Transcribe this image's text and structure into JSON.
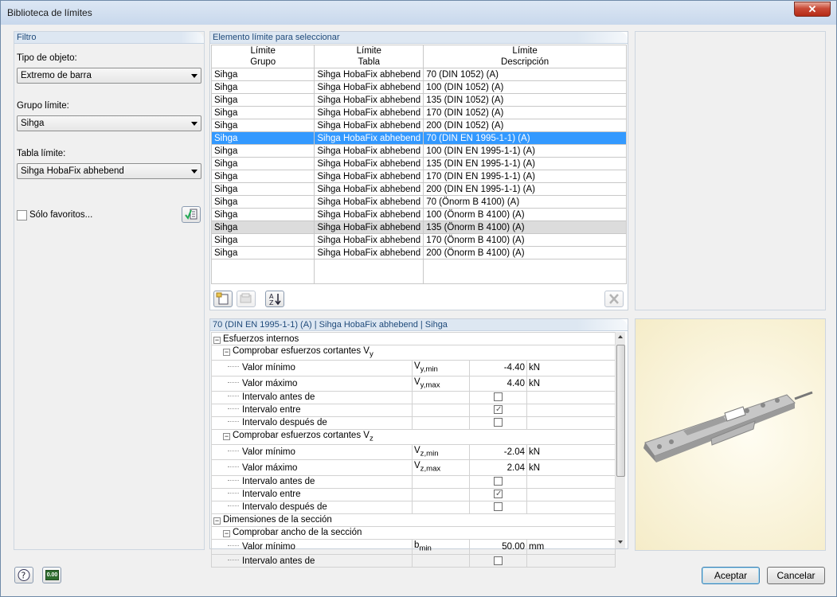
{
  "window": {
    "title": "Biblioteca de límites",
    "close_label": "✕"
  },
  "filter": {
    "header": "Filtro",
    "object_type_label": "Tipo de objeto:",
    "object_type_value": "Extremo de barra",
    "group_label": "Grupo límite:",
    "group_value": "Sihga",
    "table_label": "Tabla límite:",
    "table_value": "Sihga HobaFix abhebend",
    "favorites_label": "Sólo favoritos..."
  },
  "list": {
    "header": "Elemento límite para seleccionar",
    "columns": [
      {
        "top": "Límite",
        "bottom": "Grupo"
      },
      {
        "top": "Límite",
        "bottom": "Tabla"
      },
      {
        "top": "Límite",
        "bottom": "Descripción"
      }
    ],
    "rows": [
      [
        "Sihga",
        "Sihga HobaFix abhebend",
        "70 (DIN 1052) (A)"
      ],
      [
        "Sihga",
        "Sihga HobaFix abhebend",
        "100 (DIN 1052) (A)"
      ],
      [
        "Sihga",
        "Sihga HobaFix abhebend",
        "135 (DIN 1052) (A)"
      ],
      [
        "Sihga",
        "Sihga HobaFix abhebend",
        "170 (DIN 1052) (A)"
      ],
      [
        "Sihga",
        "Sihga HobaFix abhebend",
        "200 (DIN 1052) (A)"
      ],
      [
        "Sihga",
        "Sihga HobaFix abhebend",
        "70 (DIN EN 1995-1-1) (A)"
      ],
      [
        "Sihga",
        "Sihga HobaFix abhebend",
        "100 (DIN EN 1995-1-1) (A)"
      ],
      [
        "Sihga",
        "Sihga HobaFix abhebend",
        "135 (DIN EN 1995-1-1) (A)"
      ],
      [
        "Sihga",
        "Sihga HobaFix abhebend",
        "170 (DIN EN 1995-1-1) (A)"
      ],
      [
        "Sihga",
        "Sihga HobaFix abhebend",
        "200 (DIN EN 1995-1-1) (A)"
      ],
      [
        "Sihga",
        "Sihga HobaFix abhebend",
        "70 (Önorm B 4100) (A)"
      ],
      [
        "Sihga",
        "Sihga HobaFix abhebend",
        "100 (Önorm B 4100) (A)"
      ],
      [
        "Sihga",
        "Sihga HobaFix abhebend",
        "135 (Önorm B 4100) (A)"
      ],
      [
        "Sihga",
        "Sihga HobaFix abhebend",
        "170 (Önorm B 4100) (A)"
      ],
      [
        "Sihga",
        "Sihga HobaFix abhebend",
        "200 (Önorm B 4100) (A)"
      ]
    ],
    "selected_row": 5,
    "hover_row": 12
  },
  "details": {
    "header": "70 (DIN EN 1995-1-1) (A) | Sihga HobaFix abhebend | Sihga",
    "internal_forces": "Esfuerzos internos",
    "check_vy": "Comprobar esfuerzos cortantes V",
    "check_vy_sub": "y",
    "check_vz": "Comprobar esfuerzos cortantes V",
    "check_vz_sub": "z",
    "min_value": "Valor mínimo",
    "max_value": "Valor máximo",
    "interval_before": "Intervalo antes de",
    "interval_between": "Intervalo entre",
    "interval_after": "Intervalo después de",
    "vy_min_sym": "V",
    "vy_min_sub": "y,min",
    "vy_min": "-4.40",
    "vy_max_sym": "V",
    "vy_max_sub": "y,max",
    "vy_max": "4.40",
    "vz_min_sym": "V",
    "vz_min_sub": "z,min",
    "vz_min": "-2.04",
    "vz_max_sym": "V",
    "vz_max_sub": "z,max",
    "vz_max": "2.04",
    "unit_kn": "kN",
    "section_dims": "Dimensiones de la sección",
    "check_width": "Comprobar ancho de la sección",
    "b_min_sym": "b",
    "b_min_sub": "min",
    "b_min": "50.00",
    "unit_mm": "mm",
    "interval_between_checked": true
  },
  "buttons": {
    "ok": "Aceptar",
    "cancel": "Cancelar",
    "units_icon": "0.00"
  },
  "colors": {
    "selection": "#3399ff",
    "header_text": "#1f4a7a"
  }
}
